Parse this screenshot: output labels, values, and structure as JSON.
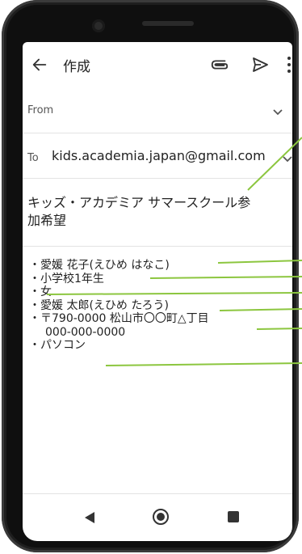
{
  "appbar": {
    "back_icon": "arrow-left-icon",
    "title": "作成",
    "attach_icon": "paperclip-icon",
    "send_icon": "send-icon",
    "more_icon": "more-vertical-icon"
  },
  "from": {
    "label": "From",
    "icon": "chevron-down-icon"
  },
  "to": {
    "label": "To",
    "value": "kids.academia.japan@gmail.com",
    "icon": "chevron-down-icon"
  },
  "subject": {
    "line1": "キッズ・アカデミア サマースクール参",
    "line2": "加希望"
  },
  "body": {
    "lines": [
      "・愛媛 花子(えひめ はなこ)",
      "・小学校1年生",
      "・女",
      "・愛媛 太郎(えひめ たろう)",
      "・〒790-0000 松山市〇〇町△丁目",
      "000-000-0000",
      "・パソコン"
    ]
  },
  "navbar": {
    "back_icon": "nav-back-triangle-icon",
    "home_icon": "nav-home-circle-icon",
    "recent_icon": "nav-recents-square-icon"
  },
  "colors": {
    "callout_line": "#8cc63f",
    "text": "#222222",
    "divider": "#e3e3e3"
  }
}
